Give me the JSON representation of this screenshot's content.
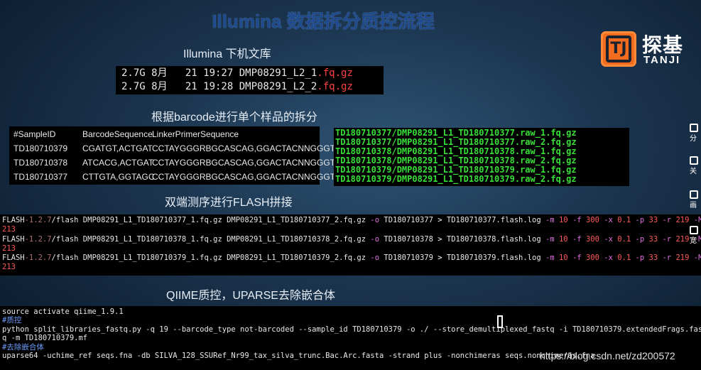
{
  "slide": {
    "title": "Illumina 数据拆分质控流程",
    "logo": {
      "cn": "探基",
      "en": "TANJI",
      "mark": "TJ"
    },
    "sections": {
      "s1": "Illumina 下机文库",
      "s2": "根据barcode进行单个样品的拆分",
      "s3": "双端测序进行FLASH拼接",
      "s4": "QIIME质控，UPARSE去除嵌合体"
    },
    "library_lines": [
      {
        "prefix": "2.7G 8月   21 19:27 DMP08291_L2_1",
        "ext": ".fq.gz"
      },
      {
        "prefix": "2.7G 8月   21 19:28 DMP08291_L2_2",
        "ext": ".fq.gz"
      }
    ],
    "barcode_table": {
      "headers": [
        "#SampleID",
        "BarcodeSequence",
        "LinkerPrimerSequence"
      ],
      "rows": [
        [
          "TD180710379",
          "CGATGT,ACTGAT",
          "CCTAYGGGRBGCASCAG,GGACTACNNGGGTATCTAAT"
        ],
        [
          "TD180710378",
          "ATCACG,ACTGAT",
          "CCTAYGGGRBGCASCAG,GGACTACNNGGGTATCTAAT"
        ],
        [
          "TD180710377",
          "CTTGTA,GGTAGC",
          "CCTAYGGGRBGCASCAG,GGACTACNNGGGTATCTAAT"
        ]
      ]
    },
    "split_files": [
      "TD180710377/DMP08291_L1_TD180710377.raw_1.fq.gz",
      "TD180710377/DMP08291_L1_TD180710377.raw_2.fq.gz",
      "TD180710378/DMP08291_L1_TD180710378.raw_1.fq.gz",
      "TD180710378/DMP08291_L1_TD180710378.raw_2.fq.gz",
      "TD180710379/DMP08291_L1_TD180710379.raw_1.fq.gz",
      "TD180710379/DMP08291_L1_TD180710379.raw_2.fq.gz"
    ],
    "flash_cmds": [
      {
        "sample": "TD180710377",
        "log": "TD180710377.flash.log"
      },
      {
        "sample": "TD180710378",
        "log": "TD180710378.flash.log"
      },
      {
        "sample": "TD180710379",
        "log": "TD180710379.flash.log"
      }
    ],
    "qiime": {
      "activate": "source activate qiime_1.9.1",
      "comment1": "#质控",
      "split_cmd": "python split_libraries_fastq.py -q 19 --barcode_type not-barcoded --sample_id TD180710379 -o ./ --store_demultiplexed_fastq -i TD180710379.extendedFrags.fast",
      "split_cmd_cont": "q -m TD180710379.mf",
      "comment2": "#去除嵌合体",
      "uparse_cmd": "uparse64 -uchime_ref seqs.fna -db SILVA_128_SSURef_Nr99_tax_silva_trunc.Bac.Arc.fasta -strand plus -nonchimeras seqs.nonchimeras.fna"
    }
  },
  "sidebar": {
    "items": [
      "分",
      "关",
      "画",
      "宽"
    ]
  },
  "watermark": "https://blog.csdn.net/zd200572",
  "colors": {
    "title": "#1f4b8e",
    "logo": "#f36c1e",
    "green": "#38e038",
    "red": "#ff4040"
  }
}
